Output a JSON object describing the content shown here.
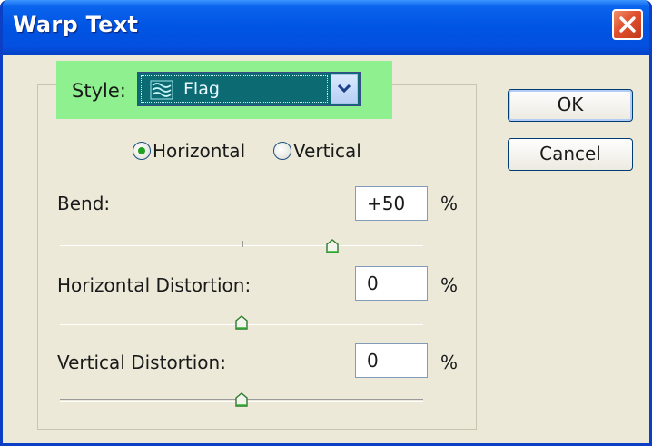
{
  "window": {
    "title": "Warp Text",
    "close_icon": "close-icon"
  },
  "style": {
    "label": "Style:",
    "value": "Flag",
    "icon": "flag-icon",
    "dropdown_icon": "chevron-down-icon"
  },
  "orientation": {
    "horizontal_label": "Horizontal",
    "vertical_label": "Vertical",
    "selected": "Horizontal"
  },
  "fields": {
    "bend": {
      "label": "Bend:",
      "value": "+50",
      "unit": "%",
      "slider_value": 50
    },
    "horizontal_distortion": {
      "label": "Horizontal Distortion:",
      "value": "0",
      "unit": "%",
      "slider_value": 0
    },
    "vertical_distortion": {
      "label": "Vertical Distortion:",
      "value": "0",
      "unit": "%",
      "slider_value": 0
    }
  },
  "buttons": {
    "ok": "OK",
    "cancel": "Cancel"
  },
  "colors": {
    "titlebar": "#0054e3",
    "highlight": "#8ef08e",
    "select_bg": "#0b6a72",
    "radio_dot": "#21a121",
    "close": "#e0502e"
  }
}
